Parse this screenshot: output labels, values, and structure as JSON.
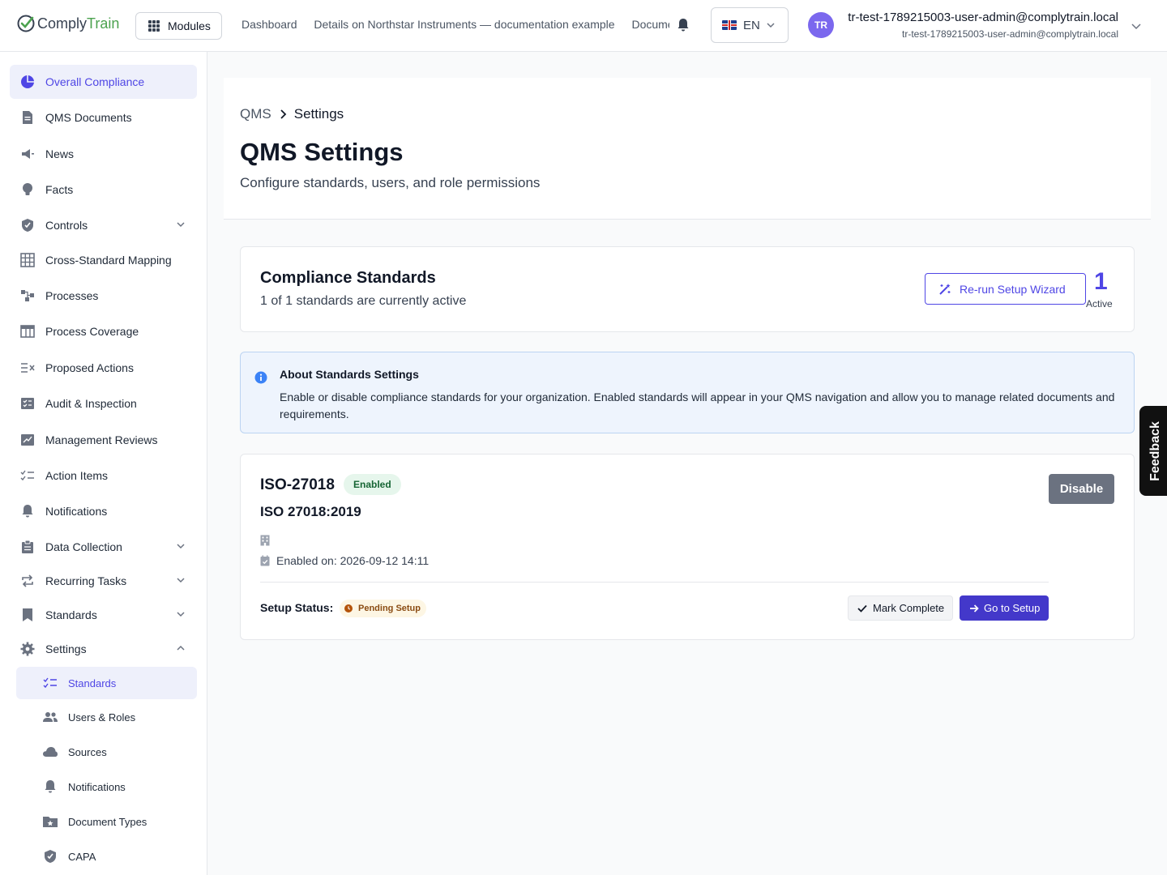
{
  "header": {
    "logo": {
      "part1": "Comply",
      "part2": "Train"
    },
    "modules_label": "Modules",
    "nav": [
      "Dashboard",
      "Details on Northstar Instruments — documentation example",
      "Documents"
    ],
    "language": "EN",
    "avatar_initials": "TR",
    "user_name": "tr-test-1789215003-user-admin@complytrain.local",
    "user_email": "tr-test-1789215003-user-admin@complytrain.local"
  },
  "sidebar": {
    "items": [
      {
        "label": "Overall Compliance",
        "icon": "pie-chart-icon",
        "active": true
      },
      {
        "label": "QMS Documents",
        "icon": "document-icon"
      },
      {
        "label": "News",
        "icon": "megaphone-icon"
      },
      {
        "label": "Facts",
        "icon": "lightbulb-icon"
      },
      {
        "label": "Controls",
        "icon": "shield-check-icon",
        "expandable": true
      },
      {
        "label": "Cross-Standard Mapping",
        "icon": "table-grid-icon"
      },
      {
        "label": "Processes",
        "icon": "flow-icon"
      },
      {
        "label": "Process Coverage",
        "icon": "table-icon"
      },
      {
        "label": "Proposed Actions",
        "icon": "list-x-icon"
      },
      {
        "label": "Audit & Inspection",
        "icon": "checklist-box-icon"
      },
      {
        "label": "Management Reviews",
        "icon": "chart-review-icon"
      },
      {
        "label": "Action Items",
        "icon": "list-check-icon"
      },
      {
        "label": "Notifications",
        "icon": "bell-icon"
      },
      {
        "label": "Data Collection",
        "icon": "clipboard-icon",
        "expandable": true
      },
      {
        "label": "Recurring Tasks",
        "icon": "repeat-icon",
        "expandable": true
      },
      {
        "label": "Standards",
        "icon": "bookmark-icon",
        "expandable": true
      },
      {
        "label": "Settings",
        "icon": "gear-icon",
        "expanded": true
      }
    ],
    "settings_sub": [
      {
        "label": "Standards",
        "icon": "list-check-icon",
        "active": true
      },
      {
        "label": "Users & Roles",
        "icon": "users-icon"
      },
      {
        "label": "Sources",
        "icon": "cloud-icon"
      },
      {
        "label": "Notifications",
        "icon": "bell-icon"
      },
      {
        "label": "Document Types",
        "icon": "folder-star-icon"
      },
      {
        "label": "CAPA",
        "icon": "shield-check-icon"
      }
    ]
  },
  "page": {
    "breadcrumb": [
      "QMS",
      "Settings"
    ],
    "title": "QMS Settings",
    "subtitle": "Configure standards, users, and role permissions"
  },
  "standards_card": {
    "title": "Compliance Standards",
    "subtitle": "1 of 1 standards are currently active",
    "rerun_label": "Re-run Setup Wizard",
    "active_count": "1",
    "active_label": "Active"
  },
  "info": {
    "title": "About Standards Settings",
    "text": "Enable or disable compliance standards for your organization. Enabled standards will appear in your QMS navigation and allow you to manage related documents and requirements."
  },
  "standard": {
    "code": "ISO-27018",
    "status": "Enabled",
    "name": "ISO 27018:2019",
    "enabled_on": "Enabled on: 2026-09-12 14:11",
    "disable_label": "Disable",
    "setup_status_label": "Setup Status:",
    "setup_status": "Pending Setup",
    "mark_complete_label": "Mark Complete",
    "go_to_setup_label": "Go to Setup"
  },
  "feedback_label": "Feedback",
  "colors": {
    "accent": "#4f46e5",
    "brand_green": "#4ca24f",
    "enabled_bg": "#e6f6ec",
    "pending_bg": "#fdf6e4"
  }
}
